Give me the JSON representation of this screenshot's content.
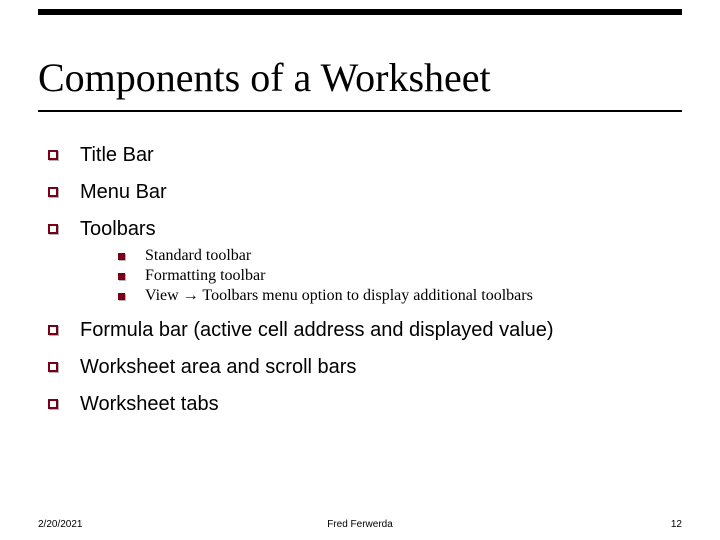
{
  "title": "Components of a Worksheet",
  "bullets": {
    "b1": "Title Bar",
    "b2": "Menu Bar",
    "b3": "Toolbars",
    "b4": "Formula bar (active cell address and displayed value)",
    "b5": "Worksheet area and scroll bars",
    "b6": "Worksheet tabs"
  },
  "sub": {
    "s1": "Standard toolbar",
    "s2": "Formatting toolbar",
    "s3": "View → Toolbars menu option to display additional toolbars"
  },
  "footer": {
    "date": "2/20/2021",
    "author": "Fred Ferwerda",
    "page": "12"
  }
}
